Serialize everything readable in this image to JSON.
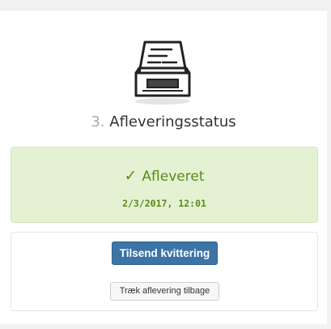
{
  "header": {
    "step_number": "3.",
    "title": "Afleveringsstatus",
    "icon": "inbox-tray-icon"
  },
  "status": {
    "label": "Afleveret",
    "icon": "checkmark-icon",
    "date": "2/3/2017, 12:01",
    "color": "#5c8a18",
    "background": "#e4f1d3"
  },
  "actions": {
    "send_receipt_label": "Tilsend kvittering",
    "withdraw_label": "Træk aflevering tilbage",
    "primary_color": "#3b74a5"
  }
}
